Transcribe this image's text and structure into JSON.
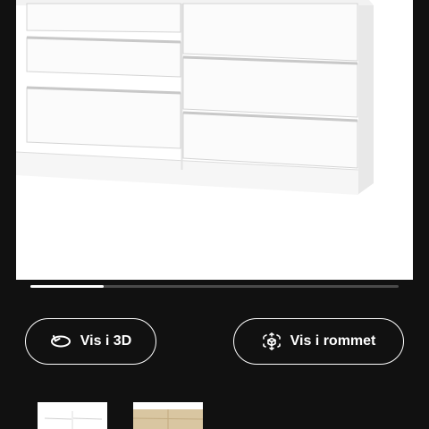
{
  "product_image": {
    "icon": "white-six-drawer-dresser",
    "background": "#ffffff"
  },
  "gallery_progress": {
    "fraction": 0.2
  },
  "actions": {
    "view_3d_label": "Vis i 3D",
    "view_3d_icon": "rotate-3d-icon",
    "view_in_room_label": "Vis i rommet",
    "view_in_room_icon": "ar-cube-icon"
  },
  "variants": [
    {
      "name": "white",
      "color": "#ffffff",
      "selected": true
    },
    {
      "name": "oak-veneer",
      "color": "#d9c6a1",
      "selected": false
    }
  ],
  "colors": {
    "background": "#111111",
    "accent": "#ffffff"
  }
}
